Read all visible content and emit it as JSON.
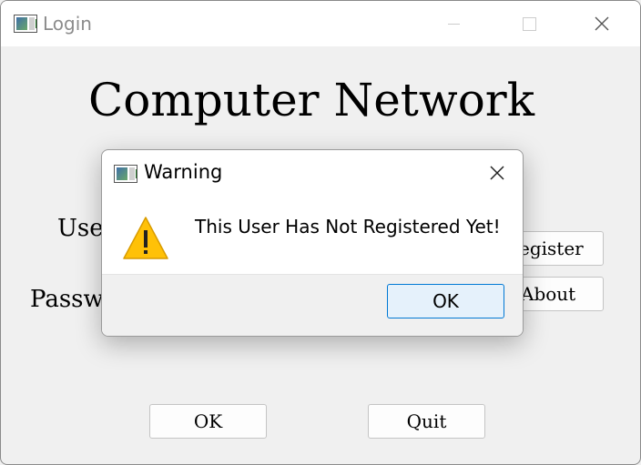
{
  "window": {
    "title": "Login"
  },
  "main": {
    "heading": "Computer Network",
    "username_label": "Use",
    "password_label": "Passw",
    "register_button": "egister",
    "about_button": "About",
    "ok_button": "OK",
    "quit_button": "Quit"
  },
  "dialog": {
    "title": "Warning",
    "message": "This User Has Not Registered Yet!",
    "ok_button": "OK",
    "icon": "warning-icon"
  },
  "colors": {
    "accent": "#0078d4",
    "warning_fill": "#ffc107",
    "titlebar_text": "#8c8c8c"
  }
}
